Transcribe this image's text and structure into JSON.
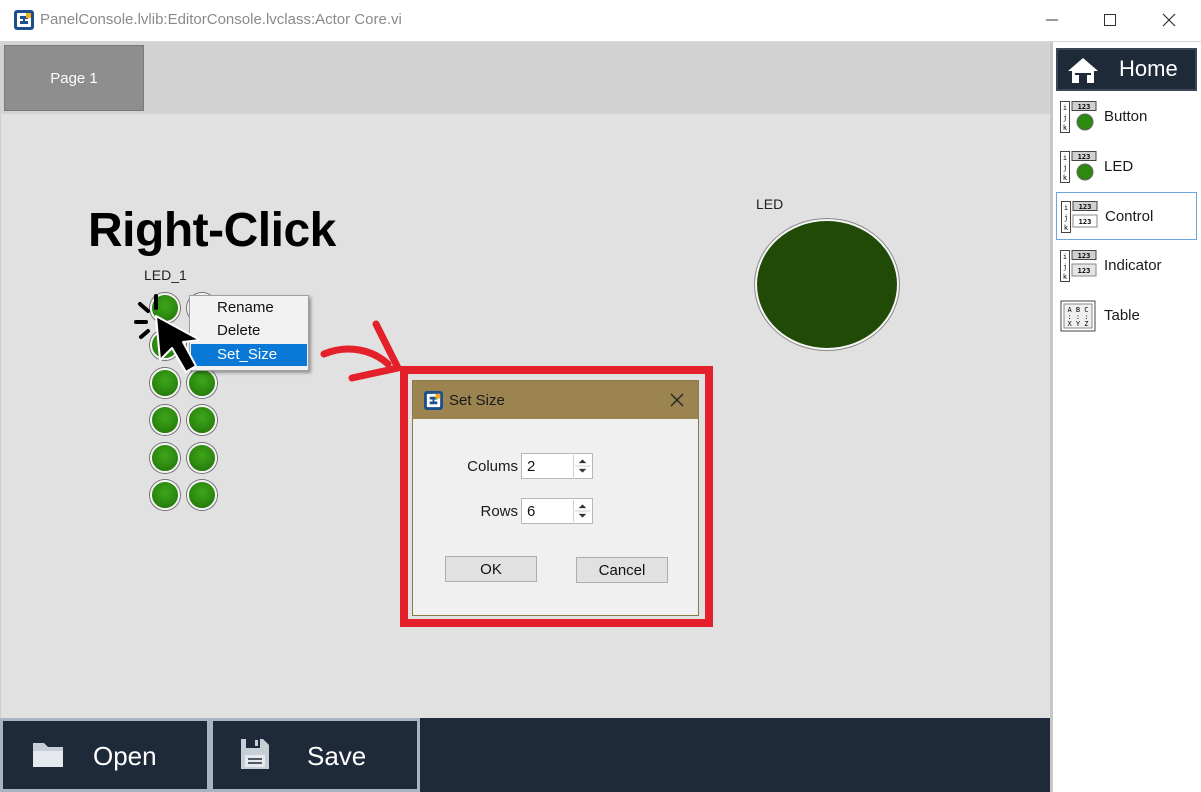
{
  "window": {
    "title": "PanelConsole.lvlib:EditorConsole.lvclass:Actor Core.vi"
  },
  "tabs": [
    {
      "label": "Page 1",
      "active": true
    }
  ],
  "canvas": {
    "annotation_text": "Right-Click",
    "led_array": {
      "label": "LED_1",
      "columns": 2,
      "rows": 6
    },
    "context_menu": {
      "items": [
        {
          "label": "Rename",
          "selected": false
        },
        {
          "label": "Delete",
          "selected": false
        },
        {
          "label": "Set_Size",
          "selected": true
        }
      ]
    },
    "led_big": {
      "label": "LED",
      "color": "#224a07"
    }
  },
  "dialog": {
    "title": "Set Size",
    "columns_label": "Colums",
    "columns_value": "2",
    "rows_label": "Rows",
    "rows_value": "6",
    "ok_label": "OK",
    "cancel_label": "Cancel",
    "highlight_color": "#e4202a"
  },
  "bottom_bar": {
    "open_label": "Open",
    "save_label": "Save"
  },
  "palette": {
    "home_label": "Home",
    "items": [
      {
        "label": "Button",
        "icon": "button-palette-icon",
        "selected": false
      },
      {
        "label": "LED",
        "icon": "led-palette-icon",
        "selected": false
      },
      {
        "label": "Control",
        "icon": "control-palette-icon",
        "selected": true
      },
      {
        "label": "Indicator",
        "icon": "indicator-palette-icon",
        "selected": false
      },
      {
        "label": "Table",
        "icon": "table-palette-icon",
        "selected": false
      }
    ]
  },
  "colors": {
    "accent_blue": "#0a78d7",
    "led_green": "#2d8a10",
    "bar_navy": "#1e2939",
    "dialog_title": "#9b844f"
  }
}
